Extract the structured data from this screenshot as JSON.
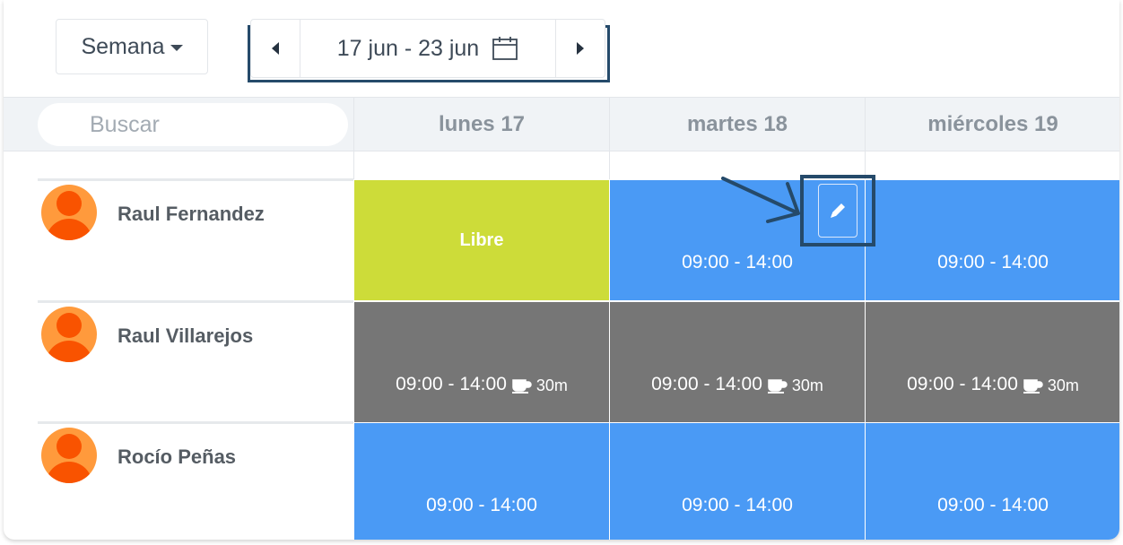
{
  "toolbar": {
    "view_label": "Semana",
    "date_range": "17 jun - 23 jun"
  },
  "search": {
    "placeholder": "Buscar"
  },
  "days": [
    "lunes 17",
    "martes 18",
    "miércoles 19"
  ],
  "employees": [
    {
      "name": "Raul Fernandez",
      "shifts": [
        {
          "type": "free",
          "label": "Libre"
        },
        {
          "type": "work",
          "label": "09:00 - 14:00"
        },
        {
          "type": "work",
          "label": "09:00 - 14:00"
        }
      ]
    },
    {
      "name": "Raul Villarejos",
      "shifts": [
        {
          "type": "work-break",
          "label": "09:00 - 14:00",
          "break": "30m"
        },
        {
          "type": "work-break",
          "label": "09:00 - 14:00",
          "break": "30m"
        },
        {
          "type": "work-break",
          "label": "09:00 - 14:00",
          "break": "30m"
        }
      ]
    },
    {
      "name": "Rocío Peñas",
      "shifts": [
        {
          "type": "work",
          "label": "09:00 - 14:00"
        },
        {
          "type": "work",
          "label": "09:00 - 14:00"
        },
        {
          "type": "work",
          "label": "09:00 - 14:00"
        }
      ]
    }
  ],
  "colors": {
    "free": "#cddc39",
    "shift": "#4a9af5",
    "break_shift": "#767676",
    "highlight": "#254a6a",
    "avatar_bg": "#ff9a3c",
    "avatar_fg": "#f95300"
  }
}
